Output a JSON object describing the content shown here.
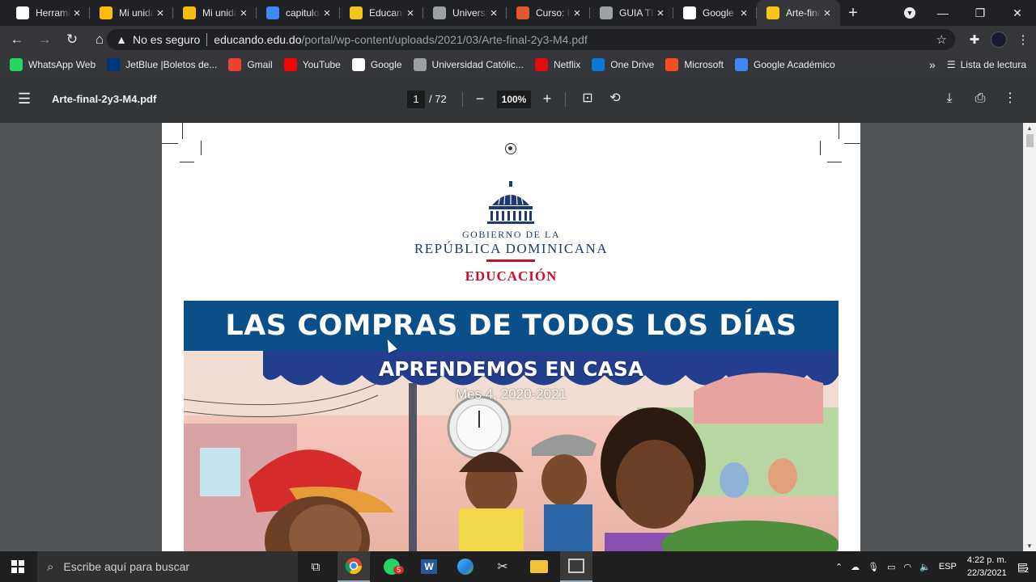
{
  "tabs": [
    {
      "title": "Herramientas",
      "icon": "pen-icon",
      "color": "#ffffff",
      "active": false
    },
    {
      "title": "Mi unidad",
      "icon": "drive-icon",
      "color": "#fbbc04",
      "active": false
    },
    {
      "title": "Mi unidad",
      "icon": "drive-icon",
      "color": "#fbbc04",
      "active": false
    },
    {
      "title": "capitulo",
      "icon": "docs-icon",
      "color": "#4285f4",
      "active": false
    },
    {
      "title": "Educando",
      "icon": "educando-icon",
      "color": "#f5c518",
      "active": false
    },
    {
      "title": "Universidad",
      "icon": "university-icon",
      "color": "#9aa0a6",
      "active": false
    },
    {
      "title": "Curso: In",
      "icon": "course-icon",
      "color": "#e2572b",
      "active": false
    },
    {
      "title": "GUIA TR",
      "icon": "globe-icon",
      "color": "#9aa0a6",
      "active": false
    },
    {
      "title": "Google",
      "icon": "google-icon",
      "color": "#ffffff",
      "active": false
    },
    {
      "title": "Arte-final",
      "icon": "educando-icon",
      "color": "#f5c518",
      "active": true
    }
  ],
  "window": {
    "minimize": "—",
    "maximize": "❐",
    "close": "✕"
  },
  "address": {
    "security": "No es seguro",
    "host": "educando.edu.do",
    "path": "/portal/wp-content/uploads/2021/03/Arte-final-2y3-M4.pdf"
  },
  "bookmarks": [
    {
      "label": "WhatsApp Web",
      "icon": "whatsapp-icon",
      "color": "#25d366"
    },
    {
      "label": "JetBlue |Boletos de...",
      "icon": "jetblue-icon",
      "color": "#003876"
    },
    {
      "label": "Gmail",
      "icon": "gmail-icon",
      "color": "#ea4335"
    },
    {
      "label": "YouTube",
      "icon": "youtube-icon",
      "color": "#ff0000"
    },
    {
      "label": "Google",
      "icon": "google-icon",
      "color": "#ffffff"
    },
    {
      "label": "Universidad Católic...",
      "icon": "university-icon",
      "color": "#9aa0a6"
    },
    {
      "label": "Netflix",
      "icon": "netflix-icon",
      "color": "#e50914"
    },
    {
      "label": "One Drive",
      "icon": "onedrive-icon",
      "color": "#0f78d4"
    },
    {
      "label": "Microsoft",
      "icon": "microsoft-icon",
      "color": "#f25022"
    },
    {
      "label": "Google Académico",
      "icon": "scholar-icon",
      "color": "#4285f4"
    }
  ],
  "bookmarks_more": "»",
  "reading_list": "Lista de lectura",
  "pdf": {
    "filename": "Arte-final-2y3-M4.pdf",
    "page": "1",
    "total": "/ 72",
    "zoom": "100%"
  },
  "document": {
    "gov_line1": "GOBIERNO DE LA",
    "gov_line2": "REPÚBLICA DOMINICANA",
    "ministry": "EDUCACIÓN",
    "title": "LAS COMPRAS DE TODOS LOS DÍAS",
    "subtitle": "APRENDEMOS EN CASA",
    "period": "Mes 4, 2020-2021"
  },
  "taskbar": {
    "search_placeholder": "Escribe aquí para buscar",
    "whatsapp_badge": "5",
    "lang": "ESP",
    "time": "4:22 p. m.",
    "date": "22/3/2021",
    "notif_badge": "2"
  }
}
